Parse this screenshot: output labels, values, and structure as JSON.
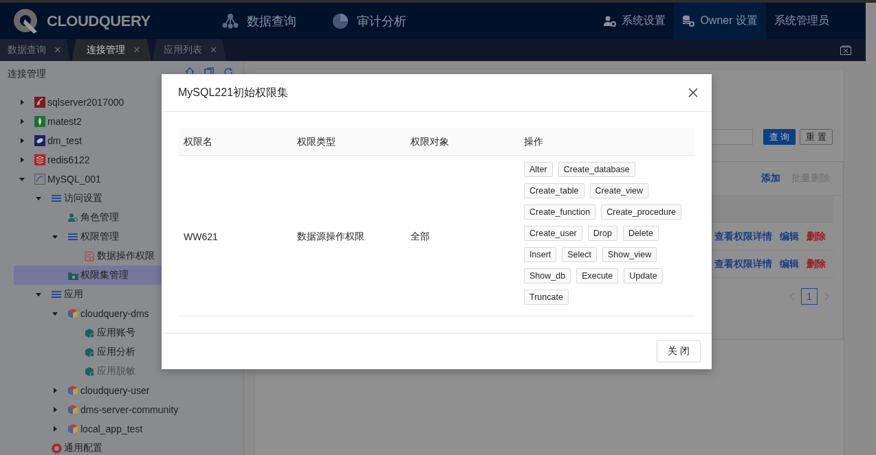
{
  "header": {
    "logo": "CLOUDQUERY",
    "nav": [
      {
        "label": "数据查询",
        "kind": "query"
      },
      {
        "label": "审计分析",
        "kind": "audit"
      }
    ],
    "right": [
      {
        "label": "系统设置",
        "kind": "system",
        "selected": false
      },
      {
        "label": "Owner 设置",
        "kind": "owner",
        "selected": true
      },
      {
        "label": "系统管理员",
        "kind": "user",
        "selected": false
      }
    ]
  },
  "tabs": [
    {
      "label": "数据查询",
      "close": "×",
      "selected": false
    },
    {
      "label": "连接管理",
      "close": "×",
      "selected": true
    },
    {
      "label": "应用列表",
      "close": "×",
      "selected": false
    }
  ],
  "sidebar": {
    "title": "连接管理",
    "tree": [
      {
        "label": "sqlserver2017000",
        "kind": "sqlserver",
        "expanded": false,
        "selected": false
      },
      {
        "label": "matest2",
        "kind": "mongo",
        "expanded": false,
        "selected": false
      },
      {
        "label": "dm_test",
        "kind": "dm",
        "expanded": false,
        "selected": false
      },
      {
        "label": "redis6122",
        "kind": "redis",
        "expanded": false,
        "selected": false
      },
      {
        "label": "MySQL_001",
        "kind": "mysql",
        "expanded": true,
        "selected": false,
        "children": [
          {
            "label": "访问设置",
            "kind": "group",
            "expanded": true,
            "selected": false,
            "children": [
              {
                "label": "角色管理",
                "kind": "role",
                "selected": false
              },
              {
                "label": "权限管理",
                "kind": "group",
                "expanded": true,
                "selected": false,
                "children": [
                  {
                    "label": "数据操作权限",
                    "kind": "perm",
                    "selected": false
                  }
                ]
              },
              {
                "label": "权限集管理",
                "kind": "permset",
                "selected": true
              }
            ]
          },
          {
            "label": "应用",
            "kind": "group",
            "expanded": true,
            "selected": false,
            "children": [
              {
                "label": "cloudquery-dms",
                "kind": "app",
                "expanded": true,
                "selected": false,
                "children": [
                  {
                    "label": "应用账号",
                    "kind": "app-item",
                    "selected": false,
                    "disabled": false
                  },
                  {
                    "label": "应用分析",
                    "kind": "app-item",
                    "selected": false,
                    "disabled": false
                  },
                  {
                    "label": "应用脱敏",
                    "kind": "app-item",
                    "selected": false,
                    "disabled": true
                  }
                ]
              },
              {
                "label": "cloudquery-user",
                "kind": "app",
                "expanded": false,
                "selected": false
              },
              {
                "label": "dms-server-community",
                "kind": "app",
                "expanded": false,
                "selected": false
              },
              {
                "label": "local_app_test",
                "kind": "app",
                "expanded": false,
                "selected": false
              }
            ]
          },
          {
            "label": "通用配置",
            "kind": "config",
            "selected": false
          }
        ]
      }
    ]
  },
  "content": {
    "search_button": "查 询",
    "reset_button": "重 置",
    "card_actions": [
      {
        "label": "添加",
        "disabled": false
      },
      {
        "label": "批量删除",
        "disabled": true
      }
    ],
    "rows": [
      {
        "actions": [
          {
            "label": "查看权限详情",
            "kind": "link"
          },
          {
            "label": "编辑",
            "kind": "link"
          },
          {
            "label": "删除",
            "kind": "danger"
          }
        ]
      },
      {
        "actions": [
          {
            "label": "查看权限详情",
            "kind": "link"
          },
          {
            "label": "编辑",
            "kind": "link"
          },
          {
            "label": "删除",
            "kind": "danger"
          }
        ]
      }
    ],
    "pagination": {
      "page": "1"
    }
  },
  "modal": {
    "title": "MySQL221初始权限集",
    "columns": [
      "权限名",
      "权限类型",
      "权限对象",
      "操作"
    ],
    "rows": [
      {
        "name": "WW621",
        "type": "数据源操作权限",
        "object": "全部",
        "operations": [
          "Alter",
          "Create_database",
          "Create_table",
          "Create_view",
          "Create_function",
          "Create_procedure",
          "Create_user",
          "Drop",
          "Delete",
          "Insert",
          "Select",
          "Show_view",
          "Show_db",
          "Execute",
          "Update",
          "Truncate"
        ]
      }
    ],
    "close_button": "关 闭"
  }
}
